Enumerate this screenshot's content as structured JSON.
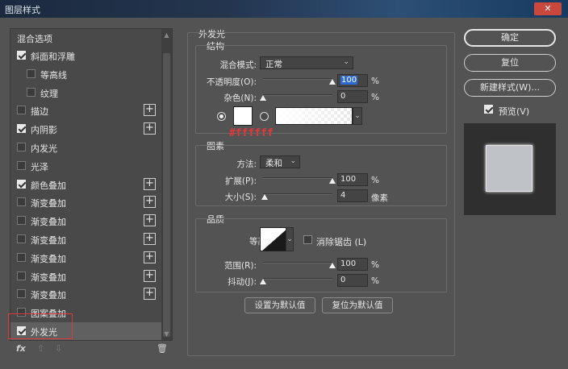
{
  "window": {
    "title": "图层样式",
    "close_glyph": "✕"
  },
  "left_panel": {
    "header": "混合选项",
    "items": [
      {
        "label": "斜面和浮雕",
        "checked": true,
        "plus": false,
        "indent": 0
      },
      {
        "label": "等高线",
        "checked": false,
        "plus": false,
        "indent": 1
      },
      {
        "label": "纹理",
        "checked": false,
        "plus": false,
        "indent": 1
      },
      {
        "label": "描边",
        "checked": false,
        "plus": true,
        "indent": 0
      },
      {
        "label": "内阴影",
        "checked": true,
        "plus": true,
        "indent": 0
      },
      {
        "label": "内发光",
        "checked": false,
        "plus": false,
        "indent": 0
      },
      {
        "label": "光泽",
        "checked": false,
        "plus": false,
        "indent": 0
      },
      {
        "label": "颜色叠加",
        "checked": true,
        "plus": true,
        "indent": 0
      },
      {
        "label": "渐变叠加",
        "checked": false,
        "plus": true,
        "indent": 0
      },
      {
        "label": "渐变叠加",
        "checked": false,
        "plus": true,
        "indent": 0
      },
      {
        "label": "渐变叠加",
        "checked": false,
        "plus": true,
        "indent": 0
      },
      {
        "label": "渐变叠加",
        "checked": false,
        "plus": true,
        "indent": 0
      },
      {
        "label": "渐变叠加",
        "checked": false,
        "plus": true,
        "indent": 0
      },
      {
        "label": "渐变叠加",
        "checked": false,
        "plus": true,
        "indent": 0
      },
      {
        "label": "图案叠加",
        "checked": false,
        "plus": false,
        "indent": 0
      },
      {
        "label": "外发光",
        "checked": true,
        "plus": false,
        "indent": 0,
        "selected": true
      }
    ],
    "footer": {
      "fx": "fx",
      "up": "⇧",
      "down": "⇩",
      "trash": "🗑"
    }
  },
  "outer_glow": {
    "section_title": "外发光",
    "structure": {
      "title": "结构",
      "blend_mode_label": "混合模式:",
      "blend_mode_value": "正常",
      "opacity_label": "不透明度(O):",
      "opacity_value": "100",
      "opacity_unit": "%",
      "opacity_fraction": 1.0,
      "noise_label": "杂色(N):",
      "noise_value": "0",
      "noise_unit": "%",
      "noise_fraction": 0.0,
      "color": "#ffffff",
      "color_annotation": "#ffffff"
    },
    "elements": {
      "title": "图素",
      "method_label": "方法:",
      "method_value": "柔和",
      "spread_label": "扩展(P):",
      "spread_value": "100",
      "spread_unit": "%",
      "spread_fraction": 1.0,
      "size_label": "大小(S):",
      "size_value": "4",
      "size_unit": "像素",
      "size_fraction": 0.02
    },
    "quality": {
      "title": "品质",
      "contour_label": "等高线:",
      "antialias_label": "消除锯齿 (L)",
      "range_label": "范围(R):",
      "range_value": "100",
      "range_unit": "%",
      "range_fraction": 1.0,
      "jitter_label": "抖动(J):",
      "jitter_value": "0",
      "jitter_unit": "%",
      "jitter_fraction": 0.0
    },
    "set_default": "设置为默认值",
    "reset_default": "复位为默认值"
  },
  "right": {
    "ok": "确定",
    "reset": "复位",
    "new_style": "新建样式(W)...",
    "preview_label": "预览(V)",
    "preview_checked": true
  },
  "colors": {
    "highlight": "#e0383c",
    "selection": "#2d6bd1"
  }
}
